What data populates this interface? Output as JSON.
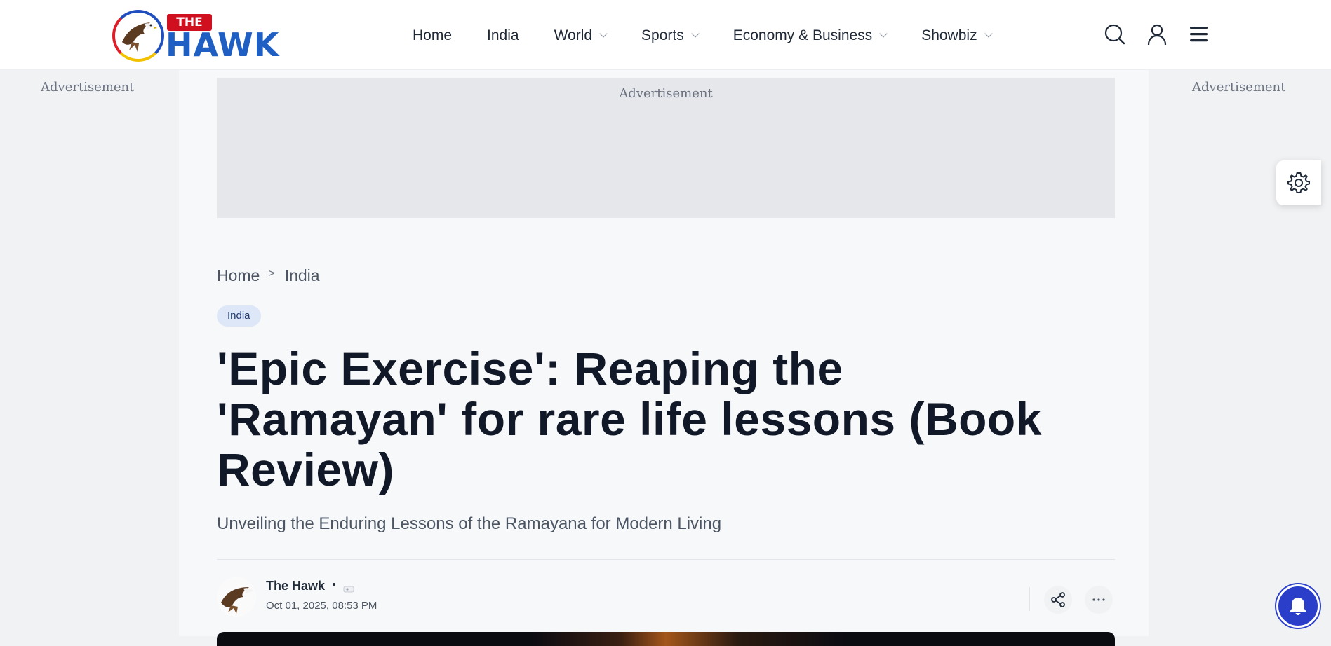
{
  "brand": {
    "logo_the": "THE",
    "logo_hawk": "HAWK"
  },
  "nav": {
    "items": [
      {
        "label": "Home",
        "has_dropdown": false
      },
      {
        "label": "India",
        "has_dropdown": false
      },
      {
        "label": "World",
        "has_dropdown": true
      },
      {
        "label": "Sports",
        "has_dropdown": true
      },
      {
        "label": "Economy & Business",
        "has_dropdown": true
      },
      {
        "label": "Showbiz",
        "has_dropdown": true
      }
    ],
    "icons": [
      "search-icon",
      "user-icon",
      "menu-icon"
    ]
  },
  "ads": {
    "left_label": "Advertisement",
    "top_label": "Advertisement",
    "right_label": "Advertisement"
  },
  "breadcrumb": {
    "items": [
      "Home",
      "India"
    ],
    "separator": ">"
  },
  "article": {
    "category": "India",
    "title": "'Epic Exercise': Reaping the 'Ramayan' for rare life lessons (Book Review)",
    "subtitle": "Unveiling the Enduring Lessons of the Ramayana for Modern Living",
    "author": "The Hawk",
    "date": "Oct 01, 2025, 08:53 PM"
  },
  "colors": {
    "brand_blue": "#1f5fc4",
    "brand_red": "#d0101e",
    "badge_bg": "#dde7f7",
    "notification_blue": "#2b3ec9"
  }
}
